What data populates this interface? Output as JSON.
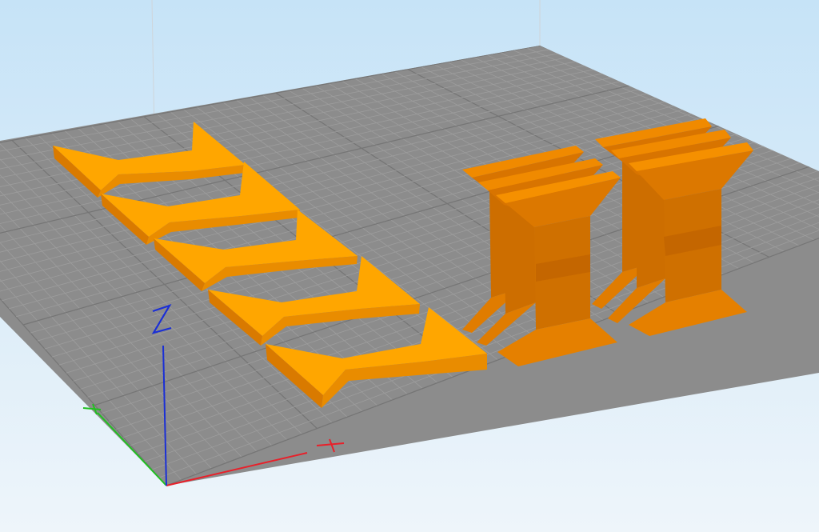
{
  "viewport": {
    "background_top": "#c6e3f7",
    "background_bottom": "#eef5fa",
    "bed_color": "#8c8c8c",
    "grid_fine_color": "#9d9d9d",
    "grid_major_color": "#757575"
  },
  "axes": {
    "x": {
      "label": "X",
      "color": "#e8202a"
    },
    "y": {
      "label": "Y",
      "color": "#20c020"
    },
    "z": {
      "label": "Z",
      "color": "#1a2fd6"
    }
  },
  "models": {
    "flat_parts": {
      "count": 5,
      "color": "#ffa500"
    },
    "stand_parts": {
      "count": 6,
      "color": "#e07800"
    }
  }
}
